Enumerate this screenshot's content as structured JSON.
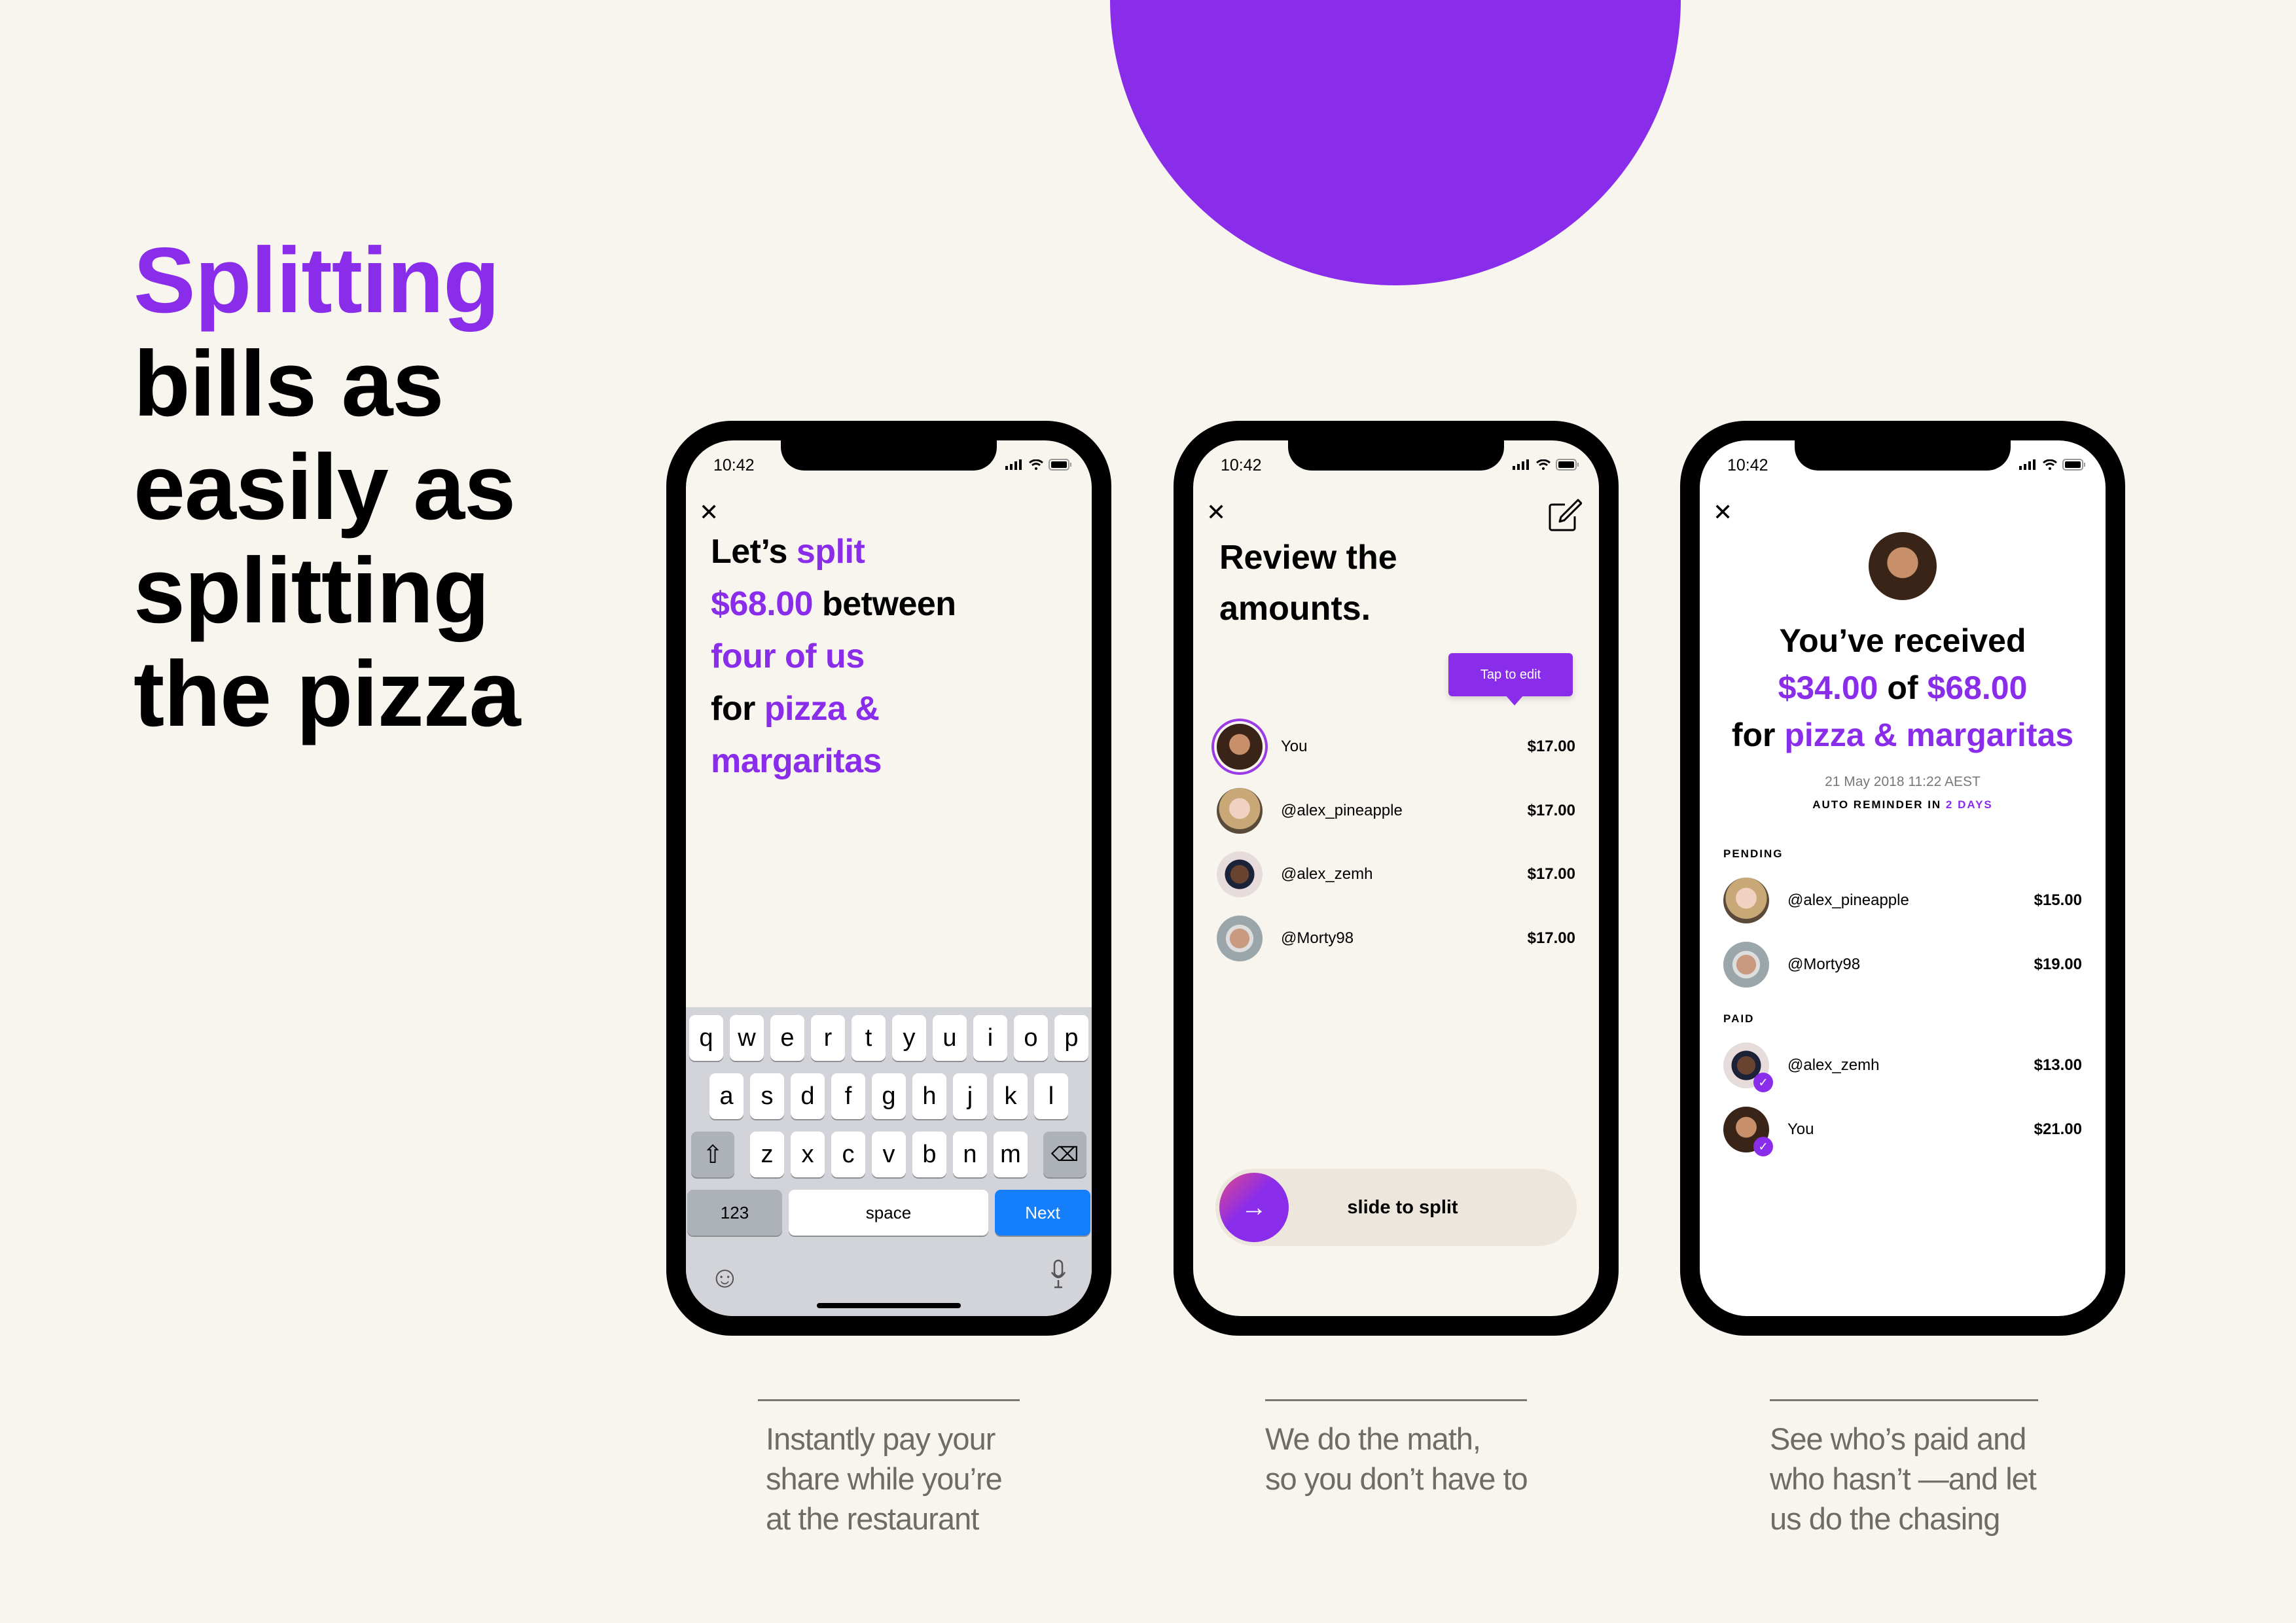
{
  "colors": {
    "accent": "#8A2DEB",
    "background": "#F8F5EF",
    "keyboard_next": "#147EFB"
  },
  "headline": {
    "accent_line": "Splitting",
    "lines": [
      "bills as",
      "easily as",
      "splitting",
      "the pizza"
    ]
  },
  "status_bar": {
    "time": "10:42",
    "icons": [
      "signal-icon",
      "wifi-icon",
      "battery-icon"
    ]
  },
  "phone1": {
    "close_icon": "✕",
    "message": [
      [
        {
          "t": "Let’s ",
          "a": false
        },
        {
          "t": "split",
          "a": true
        }
      ],
      [
        {
          "t": "$68.00",
          "a": true
        },
        {
          "t": " between",
          "a": false
        }
      ],
      [
        {
          "t": "four of us",
          "a": true
        }
      ],
      [
        {
          "t": "for ",
          "a": false
        },
        {
          "t": "pizza &",
          "a": true
        }
      ],
      [
        {
          "t": "margaritas",
          "a": true
        }
      ]
    ],
    "keyboard": {
      "row1": [
        "q",
        "w",
        "e",
        "r",
        "t",
        "y",
        "u",
        "i",
        "o",
        "p"
      ],
      "row2": [
        "a",
        "s",
        "d",
        "f",
        "g",
        "h",
        "j",
        "k",
        "l"
      ],
      "row3": [
        "z",
        "x",
        "c",
        "v",
        "b",
        "n",
        "m"
      ],
      "shift": "⇧",
      "backspace": "⌫",
      "numbers": "123",
      "space": "space",
      "next": "Next",
      "emoji": "☺",
      "mic": "🎙"
    }
  },
  "phone2": {
    "title_lines": [
      "Review the",
      "amounts."
    ],
    "tooltip": "Tap to edit",
    "rows": [
      {
        "name": "You",
        "amount": "$17.00",
        "highlight": true
      },
      {
        "name": "@alex_pineapple",
        "amount": "$17.00"
      },
      {
        "name": "@alex_zemh",
        "amount": "$17.00"
      },
      {
        "name": "@Morty98",
        "amount": "$17.00"
      }
    ],
    "slider_label": "slide to split",
    "slider_arrow": "→"
  },
  "phone3": {
    "title": {
      "line1": "You’ve received",
      "received": "$34.00",
      "of": " of ",
      "total": "$68.00",
      "for": "for ",
      "item": "pizza & margaritas"
    },
    "date": "21 May 2018 11:22 AEST",
    "reminder": {
      "prefix": "AUTO REMINDER IN ",
      "value": "2 DAYS"
    },
    "pending_label": "PENDING",
    "pending": [
      {
        "name": "@alex_pineapple",
        "amount": "$15.00"
      },
      {
        "name": "@Morty98",
        "amount": "$19.00"
      }
    ],
    "paid_label": "PAID",
    "paid": [
      {
        "name": "@alex_zemh",
        "amount": "$13.00"
      },
      {
        "name": "You",
        "amount": "$21.00"
      }
    ],
    "check": "✓"
  },
  "captions": [
    [
      "Instantly pay your",
      "share while you’re",
      "at the restaurant"
    ],
    [
      "We do the math,",
      "so you don’t have to"
    ],
    [
      "See who’s paid and",
      "who hasn’t —and let",
      "us do the chasing"
    ]
  ]
}
